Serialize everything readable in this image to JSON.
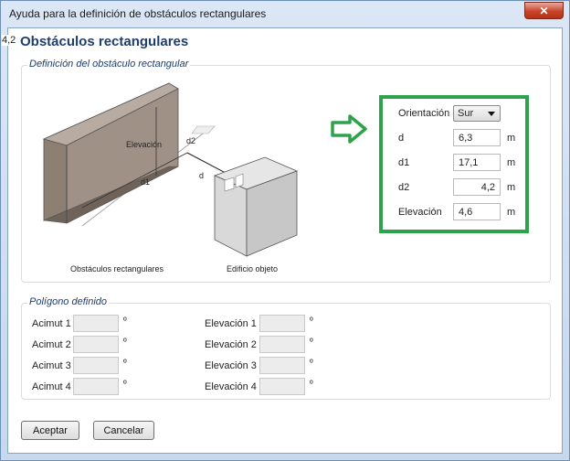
{
  "window": {
    "title": "Ayuda para la definición de obstáculos rectangulares",
    "close_glyph": "✕"
  },
  "corner_label": "4,2",
  "heading": "Obstáculos rectangulares",
  "definition_group": {
    "legend": "Definición del obstáculo rectangular",
    "diagram": {
      "label_elevacion": "Elevación",
      "label_d2": "d2",
      "label_d": "d",
      "label_d1": "d1",
      "caption_obstacles": "Obstáculos rectangulares",
      "caption_building": "Edificio objeto"
    },
    "arrow_icon": "right-arrow-icon",
    "fields": {
      "orientacion_label": "Orientación",
      "orientacion_value": "Sur",
      "d_label": "d",
      "d_value": "6,3",
      "d1_label": "d1",
      "d1_value": "17,1",
      "d2_label": "d2",
      "d2_value": "4,2",
      "elevacion_label": "Elevación",
      "elevacion_value": "4,6",
      "unit": "m"
    },
    "highlight_color": "#2fa34b"
  },
  "polygon_group": {
    "legend": "Polígono definido",
    "azimuths": [
      "Acimut 1",
      "Acimut 2",
      "Acimut 3",
      "Acimut 4"
    ],
    "elevations": [
      "Elevación 1",
      "Elevación 2",
      "Elevación 3",
      "Elevación 4"
    ],
    "degree_symbol": "º"
  },
  "buttons": {
    "accept": "Aceptar",
    "cancel": "Cancelar"
  },
  "colors": {
    "heading": "#1f3d6e",
    "close_button": "#c7442b"
  }
}
